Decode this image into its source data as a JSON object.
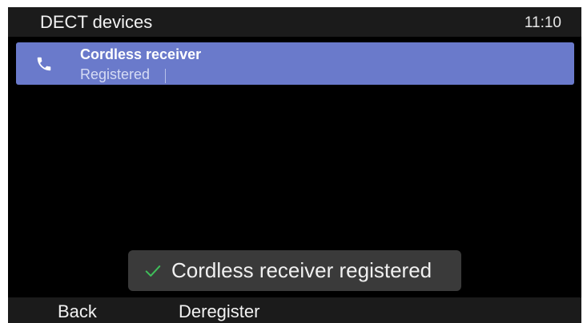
{
  "header": {
    "title": "DECT devices",
    "time": "11:10"
  },
  "devices": [
    {
      "icon": "phone-handset-icon",
      "name": "Cordless receiver",
      "status": "Registered",
      "selected": true
    }
  ],
  "toast": {
    "icon": "checkmark-icon",
    "message": "Cordless receiver registered"
  },
  "softkeys": {
    "back": "Back",
    "deregister": "Deregister"
  },
  "colors": {
    "selected_row": "#6a7acb",
    "check": "#3fbf5a"
  }
}
